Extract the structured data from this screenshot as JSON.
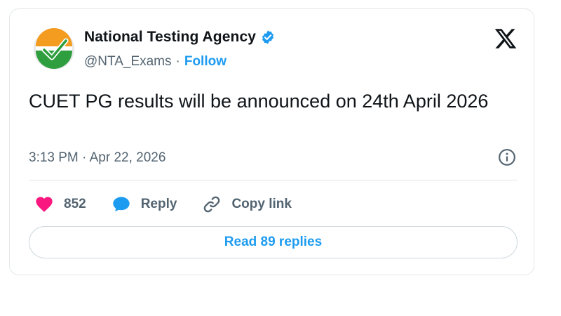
{
  "account": {
    "name": "National Testing Agency",
    "handle": "@NTA_Exams",
    "separator": "·",
    "follow_label": "Follow",
    "avatar_icon": "nta-logo",
    "verified_icon": "verified-badge-icon"
  },
  "platform_icon": "x-logo-icon",
  "tweet": {
    "text": "CUET PG results will be announced on 24th April 2026",
    "timestamp": "3:13 PM · Apr 22, 2026"
  },
  "actions": {
    "likes_count": "852",
    "reply_label": "Reply",
    "copy_link_label": "Copy link"
  },
  "read_replies_label": "Read 89 replies",
  "colors": {
    "accent": "#1d9bf0",
    "like": "#f91880",
    "text": "#0f1419",
    "muted": "#536471",
    "logo_orange": "#f39c1f",
    "logo_green": "#2e9e3e"
  }
}
